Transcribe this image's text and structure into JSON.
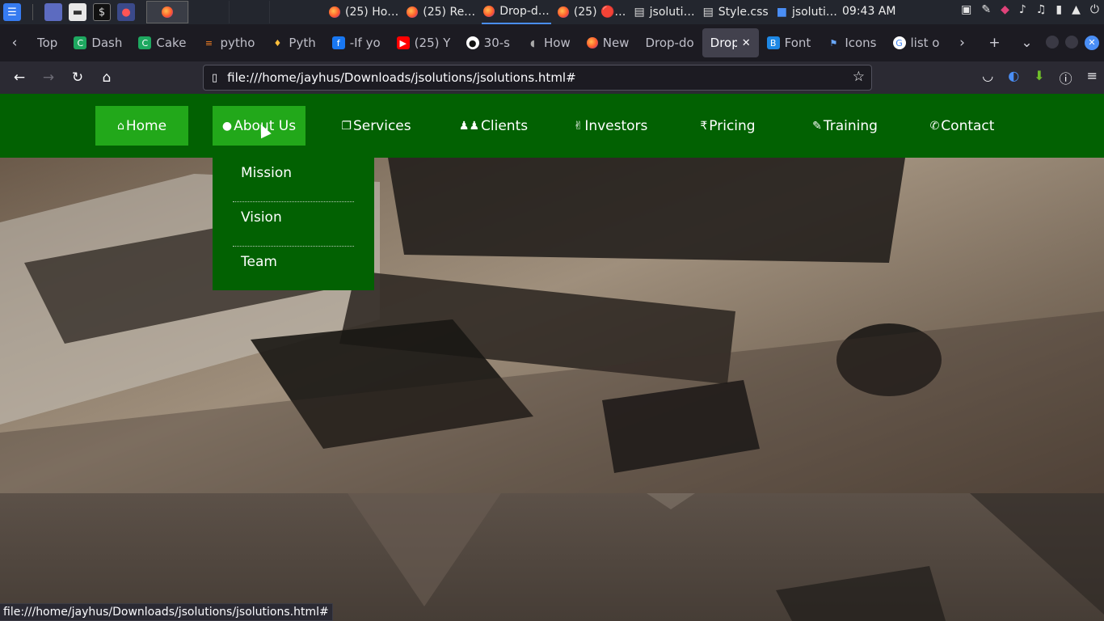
{
  "taskbar": {
    "launchers": [
      {
        "icon": "kali-menu-icon"
      },
      {
        "icon": "workspace-icon"
      },
      {
        "icon": "file-manager-icon"
      },
      {
        "icon": "terminal-icon"
      },
      {
        "icon": "screen-recorder-icon"
      }
    ],
    "windows": [
      {
        "label": "(25) Ho…"
      },
      {
        "label": "(25) Re…"
      },
      {
        "label": "Drop-d…",
        "active": true
      },
      {
        "label": "(25) 🔴…"
      },
      {
        "label": "jsoluti…"
      },
      {
        "label": "Style.css"
      },
      {
        "label": "jsoluti…"
      }
    ],
    "clock": "09:43 AM"
  },
  "tabs": [
    {
      "label": "Top"
    },
    {
      "label": "Dash"
    },
    {
      "label": "Cake"
    },
    {
      "label": "pytho"
    },
    {
      "label": "Pyth"
    },
    {
      "label": "-If yo"
    },
    {
      "label": "(25) Y"
    },
    {
      "label": "30-s"
    },
    {
      "label": "How"
    },
    {
      "label": "New"
    },
    {
      "label": "Drop-do"
    },
    {
      "label": "Drop-",
      "selected": true
    },
    {
      "label": "Font"
    },
    {
      "label": "Icons"
    },
    {
      "label": "list o"
    }
  ],
  "address": {
    "url": "file:///home/jayhus/Downloads/jsolutions/jsolutions.html#"
  },
  "site": {
    "menu": [
      {
        "label": "Home",
        "icon": "home-icon",
        "glyph": "⌂"
      },
      {
        "label": "About Us",
        "icon": "user-icon",
        "glyph": "●",
        "highlight": true
      },
      {
        "label": "Services",
        "icon": "copy-icon",
        "glyph": "❐"
      },
      {
        "label": "Clients",
        "icon": "users-icon",
        "glyph": "👥"
      },
      {
        "label": "Investors",
        "icon": "peace-hand-icon",
        "glyph": "✌"
      },
      {
        "label": "Pricing",
        "icon": "rupee-icon",
        "glyph": "₹"
      },
      {
        "label": "Training",
        "icon": "edit-icon",
        "glyph": "✎"
      },
      {
        "label": "Contact",
        "icon": "phone-icon",
        "glyph": "✆"
      }
    ],
    "dropdown": [
      {
        "label": "Mission"
      },
      {
        "label": "Vision"
      },
      {
        "label": "Team"
      }
    ]
  },
  "status": {
    "hover_url": "file:///home/jayhus/Downloads/jsolutions/jsolutions.html#"
  },
  "colors": {
    "menu_bg": "#026102",
    "menu_highlight": "#22a81a",
    "browser_chrome": "#2b2a33"
  }
}
